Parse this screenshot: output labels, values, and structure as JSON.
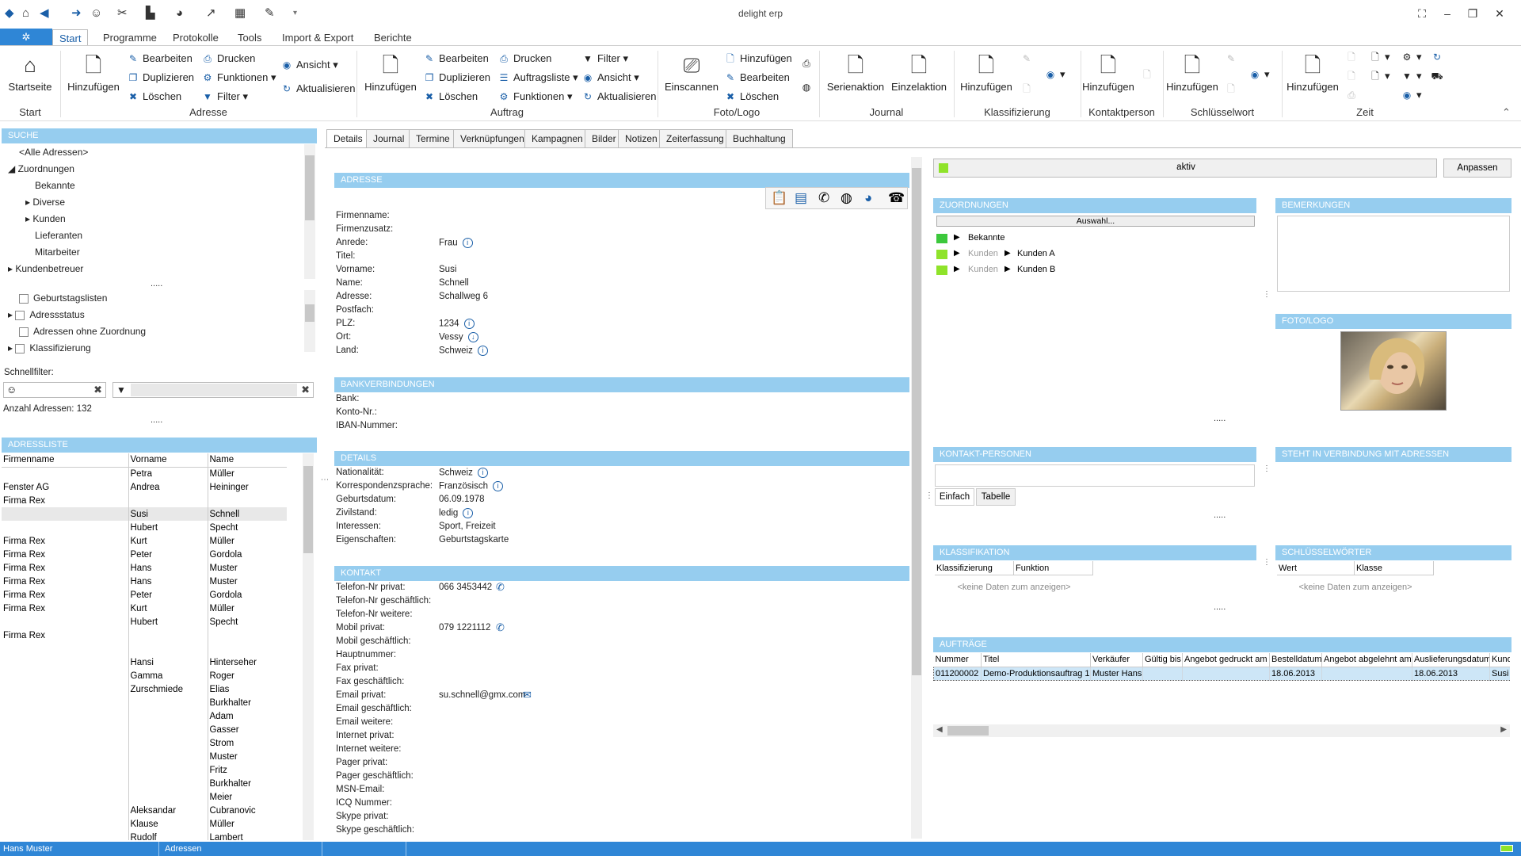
{
  "app": {
    "title": "delight erp"
  },
  "ribbon": {
    "tabs": [
      "Start",
      "Programme",
      "Protokolle",
      "Tools",
      "Import & Export",
      "Berichte"
    ],
    "buttons": {
      "startseite": "Startseite",
      "hinzufuegen": "Hinzufügen",
      "bearbeiten": "Bearbeiten",
      "duplizieren": "Duplizieren",
      "loeschen": "Löschen",
      "drucken": "Drucken",
      "funktionen": "Funktionen",
      "filter": "Filter",
      "ansicht": "Ansicht",
      "aktualisieren": "Aktualisieren",
      "auftragsliste": "Auftragsliste",
      "einscannen": "Einscannen",
      "serienaktion": "Serienaktion",
      "einzelaktion": "Einzelaktion"
    },
    "groups": [
      "Start",
      "Adresse",
      "Auftrag",
      "Foto/Logo",
      "Journal",
      "Klassifizierung",
      "Kontaktperson",
      "Schlüsselwort",
      "Zeit"
    ]
  },
  "search": {
    "header": "SUCHE",
    "tree": [
      "<Alle Adressen>",
      "Zuordnungen",
      "Bekannte",
      "Diverse",
      "Kunden",
      "Lieferanten",
      "Mitarbeiter",
      "Kundenbetreuer"
    ],
    "checks": [
      "Geburtstagslisten",
      "Adressstatus",
      "Adressen ohne Zuordnung",
      "Klassifizierung"
    ],
    "quickfilter_label": "Schnellfilter:",
    "count": "Anzahl Adressen: 132",
    "dots": "....."
  },
  "list": {
    "header": "ADRESSLISTE",
    "columns": [
      "Firmenname",
      "Vorname",
      "Name"
    ],
    "rows": [
      [
        "",
        "Petra",
        "Müller"
      ],
      [
        "Fenster AG",
        "Andrea",
        "Heininger"
      ],
      [
        "Firma Rex",
        "",
        ""
      ],
      [
        "",
        "Susi",
        "Schnell"
      ],
      [
        "",
        "Hubert",
        "Specht"
      ],
      [
        "Firma Rex",
        "Kurt",
        "Müller"
      ],
      [
        "Firma Rex",
        "Peter",
        "Gordola"
      ],
      [
        "Firma Rex",
        "Hans",
        "Muster"
      ],
      [
        "Firma Rex",
        "Hans",
        "Muster"
      ],
      [
        "Firma Rex",
        "Peter",
        "Gordola"
      ],
      [
        "Firma Rex",
        "Kurt",
        "Müller"
      ],
      [
        "",
        "Hubert",
        "Specht"
      ],
      [
        "Firma Rex",
        "",
        ""
      ],
      [
        "",
        "",
        ""
      ],
      [
        "",
        "Hansi",
        "Hinterseher"
      ],
      [
        "",
        "Gamma",
        "Roger"
      ],
      [
        "",
        "Zurschmiede",
        "Elias"
      ],
      [
        "",
        "",
        "Burkhalter"
      ],
      [
        "",
        "",
        "Adam"
      ],
      [
        "",
        "",
        "Gasser"
      ],
      [
        "",
        "",
        "Strom"
      ],
      [
        "",
        "",
        "Muster"
      ],
      [
        "",
        "",
        "Fritz"
      ],
      [
        "",
        "",
        "Burkhalter"
      ],
      [
        "",
        "",
        "Meier"
      ],
      [
        "",
        "Aleksandar",
        "Cubranovic"
      ],
      [
        "",
        "Klause",
        "Müller"
      ],
      [
        "",
        "Rudolf",
        "Lambert"
      ]
    ]
  },
  "detailtabs": [
    "Details",
    "Journal",
    "Termine",
    "Verknüpfungen",
    "Kampagnen",
    "Bilder",
    "Notizen",
    "Zeiterfassung",
    "Buchhaltung"
  ],
  "address": {
    "header": "ADRESSE",
    "fields": [
      [
        "Firmenname:",
        ""
      ],
      [
        "Firmenzusatz:",
        ""
      ],
      [
        "Anrede:",
        "Frau"
      ],
      [
        "Titel:",
        ""
      ],
      [
        "Vorname:",
        "Susi"
      ],
      [
        "Name:",
        "Schnell"
      ],
      [
        "Adresse:",
        "Schallweg 6"
      ],
      [
        "Postfach:",
        ""
      ],
      [
        "PLZ:",
        "1234"
      ],
      [
        "Ort:",
        "Vessy"
      ],
      [
        "Land:",
        "Schweiz"
      ]
    ]
  },
  "bank": {
    "header": "BANKVERBINDUNGEN",
    "fields": [
      [
        "Bank:",
        ""
      ],
      [
        "Konto-Nr.:",
        ""
      ],
      [
        "IBAN-Nummer:",
        ""
      ]
    ]
  },
  "details": {
    "header": "DETAILS",
    "fields": [
      [
        "Nationalität:",
        "Schweiz"
      ],
      [
        "Korrespondenzsprache:",
        "Französisch"
      ],
      [
        "Geburtsdatum:",
        "06.09.1978"
      ],
      [
        "Zivilstand:",
        "ledig"
      ],
      [
        "Interessen:",
        "Sport,  Freizeit"
      ],
      [
        "Eigenschaften:",
        "Geburtstagskarte"
      ]
    ]
  },
  "kontakt": {
    "header": "KONTAKT",
    "fields": [
      [
        "Telefon-Nr privat:",
        "066 3453442"
      ],
      [
        "Telefon-Nr geschäftlich:",
        ""
      ],
      [
        "Telefon-Nr weitere:",
        ""
      ],
      [
        "Mobil privat:",
        "079 1221112"
      ],
      [
        "Mobil geschäftlich:",
        ""
      ],
      [
        "Hauptnummer:",
        ""
      ],
      [
        "Fax privat:",
        ""
      ],
      [
        "Fax geschäftlich:",
        ""
      ],
      [
        "Email privat:",
        "su.schnell@gmx.com"
      ],
      [
        "Email geschäftlich:",
        ""
      ],
      [
        "Email weitere:",
        ""
      ],
      [
        "Internet privat:",
        ""
      ],
      [
        "Internet weitere:",
        ""
      ],
      [
        "Pager privat:",
        ""
      ],
      [
        "Pager geschäftlich:",
        ""
      ],
      [
        "MSN-Email:",
        ""
      ],
      [
        "ICQ Nummer:",
        ""
      ],
      [
        "Skype privat:",
        ""
      ],
      [
        "Skype geschäftlich:",
        ""
      ]
    ]
  },
  "status": {
    "value": "aktiv",
    "button": "Anpassen",
    "color": "#8fe32a"
  },
  "zuordnungen": {
    "header": "ZUORDNUNGEN",
    "auswahl": "Auswahl...",
    "items": [
      {
        "parent": "",
        "label": "Bekannte",
        "color": "#3cc83c"
      },
      {
        "parent": "Kunden",
        "label": "Kunden A",
        "color": "#8fe32a"
      },
      {
        "parent": "Kunden",
        "label": "Kunden B",
        "color": "#8fe32a"
      }
    ]
  },
  "bemerkungen": {
    "header": "BEMERKUNGEN"
  },
  "foto": {
    "header": "FOTO/LOGO"
  },
  "kontaktpersonen": {
    "header": "KONTAKT-PERSONEN",
    "tabs": [
      "Einfach",
      "Tabelle"
    ]
  },
  "verbindung": {
    "header": "STEHT IN VERBINDUNG MIT ADRESSEN"
  },
  "klassifikation": {
    "header": "KLASSIFIKATION",
    "columns": [
      "Klassifizierung",
      "Funktion"
    ],
    "empty": "<keine Daten zum anzeigen>"
  },
  "schluessel": {
    "header": "SCHLÜSSELWÖRTER",
    "columns": [
      "Wert",
      "Klasse"
    ],
    "empty": "<keine Daten zum anzeigen>"
  },
  "auftraege": {
    "header": "AUFTRÄGE",
    "columns": [
      "Nummer",
      "Titel",
      "Verkäufer",
      "Gültig bis",
      "Angebot gedruckt am",
      "Bestelldatum",
      "Angebot abgelehnt am",
      "Auslieferungsdatum",
      "Kund"
    ],
    "rows": [
      [
        "011200002",
        "Demo-Produktionsauftrag 1",
        "Muster Hans",
        "",
        "",
        "18.06.2013",
        "",
        "18.06.2013",
        "Susi S"
      ]
    ]
  },
  "statusbar": {
    "user": "Hans Muster",
    "module": "Adressen"
  },
  "colors": {
    "accent": "#2f86d6",
    "header": "#96cdef"
  }
}
